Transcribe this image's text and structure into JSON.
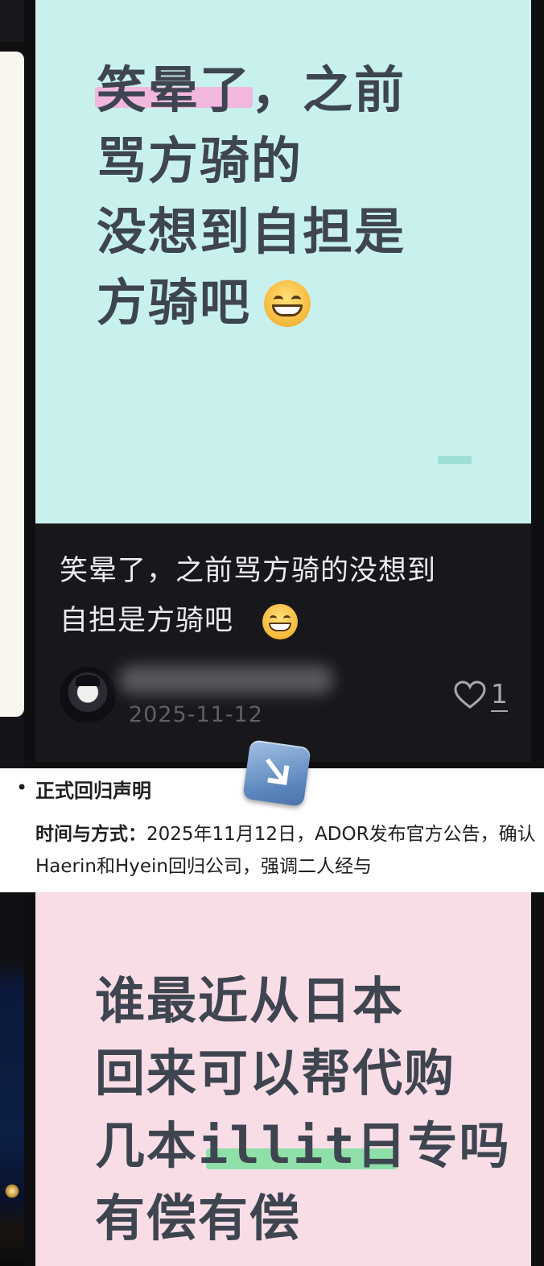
{
  "top_post": {
    "cover_text": "笑晕了，之前\n骂方骑的\n没想到自担是\n方骑吧",
    "caption": "笑晕了，之前骂方骑的没想到\n自担是方骑吧",
    "author_name": "",
    "date": "2025-11-12",
    "like_count": "1",
    "icons": [
      "grinning-face-emoji",
      "heart-icon"
    ]
  },
  "snippet": {
    "bullet": "•",
    "heading": "正式回归声明",
    "detail_label": "时间与方式：",
    "detail_text": "2025年11月12日，ADOR发布官方公告，确认Haerin和Hyein回归公司，强调二人经与"
  },
  "overlay": {
    "icon": "down-right-arrow-emoji"
  },
  "bottom_post": {
    "cover_text": "谁最近从日本\n回来可以帮代购\n几本illit日专吗\n有偿有偿"
  },
  "colors": {
    "cover_mint": "#c8f1ee",
    "cover_pink": "#f9dde6",
    "highlight_pink": "#f2b7dc",
    "highlight_green": "#8fe0a8",
    "card_dark": "#18181c"
  }
}
